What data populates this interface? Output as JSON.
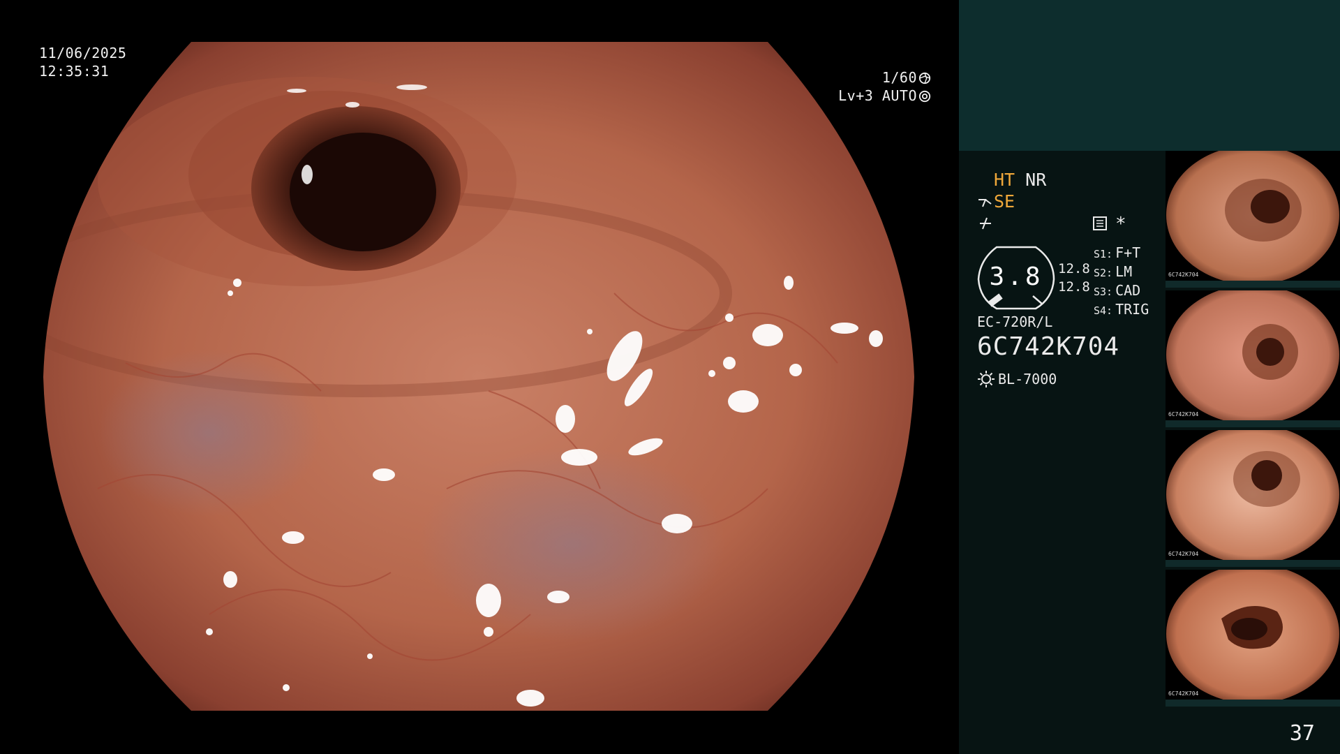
{
  "main_view": {
    "date": "11/06/2025",
    "time": "12:35:31",
    "shutter": "1/60",
    "shutter_icon": "aperture-icon",
    "level": "Lv+3",
    "exposure_mode": "AUTO",
    "exposure_icon": "iris-icon"
  },
  "side_panel": {
    "mode_ht": "HT",
    "mode_nr": "NR",
    "mode_se": "SE",
    "freeze_icon": "freeze-icon",
    "memory_icon": "memory-card-icon",
    "asterisk": "*",
    "gauge_value": "3.8",
    "gauge_nums": [
      "12.8",
      "12.8"
    ],
    "slots": [
      {
        "key": "S1:",
        "value": "F+T"
      },
      {
        "key": "S2:",
        "value": "LM"
      },
      {
        "key": "S3:",
        "value": "CAD"
      },
      {
        "key": "S4:",
        "value": "TRIG"
      }
    ],
    "scope_model": "EC-720R/L",
    "scope_serial": "6C742K704",
    "light_source_icon": "light-source-icon",
    "light_source": "BL-7000",
    "thumbnails": [
      {
        "label": "6C742K704"
      },
      {
        "label": "6C742K704"
      },
      {
        "label": "6C742K704"
      },
      {
        "label": "6C742K704"
      }
    ],
    "page_number": "37"
  },
  "colors": {
    "accent_orange": "#f0a83a",
    "panel_dark": "#071413",
    "panel_teal": "#0d2d2d",
    "mucosa": "#b46a4e"
  }
}
